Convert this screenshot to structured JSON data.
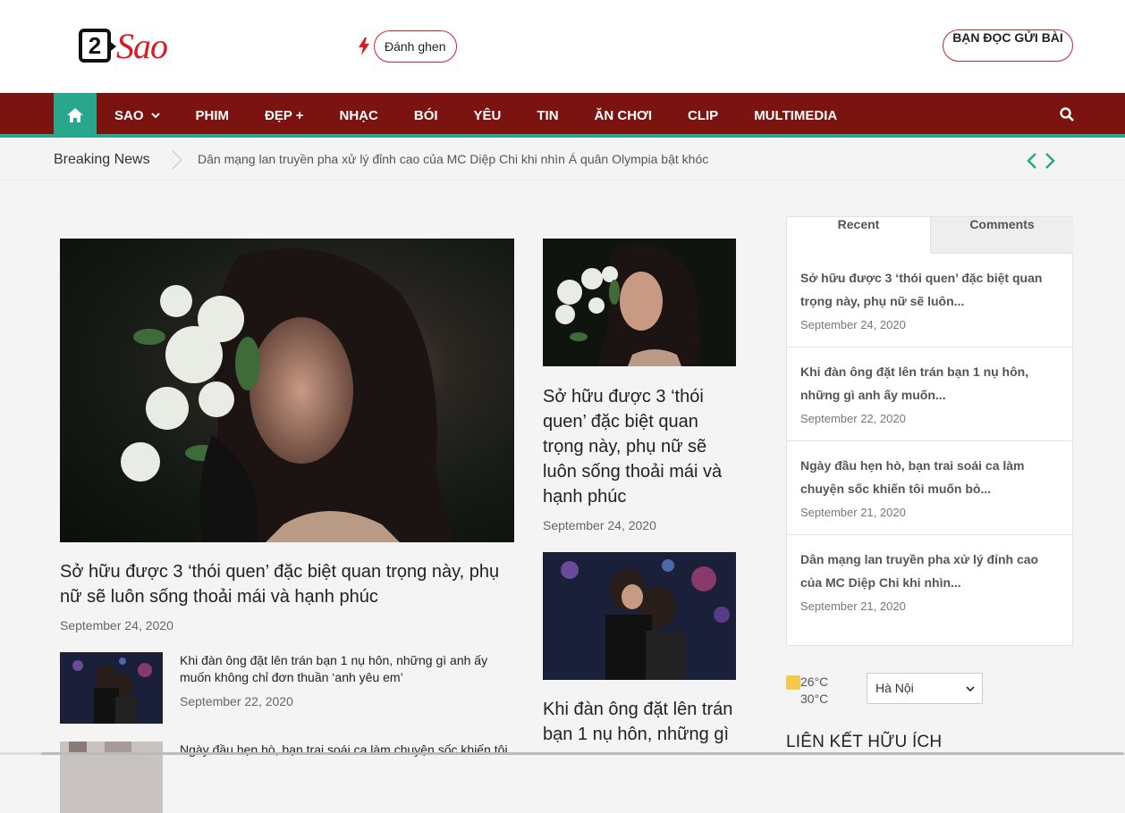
{
  "header": {
    "logo_text": "Sao",
    "logo_number": "2",
    "hot_tag": "Đánh ghen",
    "submit_button": "BẠN ĐỌC GỬI BÀI"
  },
  "nav": {
    "items": [
      "SAO",
      "PHIM",
      "ĐẸP +",
      "NHẠC",
      "BÓI",
      "YÊU",
      "TIN",
      "ĂN CHƠI",
      "CLIP",
      "MULTIMEDIA"
    ]
  },
  "breaking": {
    "label": "Breaking News",
    "headline": "Dân mạng lan truyền pha xử lý đỉnh cao của MC Diệp Chi khi nhìn Á quân Olympia bật khóc"
  },
  "main": {
    "featured": {
      "title": "Sở hữu được 3 ‘thói quen’ đặc biệt quan trọng này, phụ nữ sẽ luôn sống thoải mái và hạnh phúc",
      "date": "September 24, 2020"
    },
    "small_posts": [
      {
        "title": "Khi đàn ông đặt lên trán bạn 1 nụ hôn, những gì anh ấy muốn không chỉ đơn thuần ‘anh yêu em’",
        "date": "September 22, 2020"
      },
      {
        "title": "Ngày đầu hẹn hò, bạn trai soái ca làm chuyện sốc khiến tôi",
        "date": ""
      }
    ],
    "middle_posts": [
      {
        "title": "Sở hữu được 3 ‘thói quen’ đặc biệt quan trọng này, phụ nữ sẽ luôn sống thoải mái và hạnh phúc",
        "date": "September 24, 2020"
      },
      {
        "title": "Khi đàn ông đặt lên trán bạn 1 nụ hôn, những gì",
        "date": ""
      }
    ]
  },
  "sidebar": {
    "tabs": [
      "Recent",
      "Comments"
    ],
    "recent": [
      {
        "title": "Sở hữu được 3 ‘thói quen’ đặc biệt quan trọng này, phụ nữ sẽ luôn...",
        "date": "September 24, 2020"
      },
      {
        "title": "Khi đàn ông đặt lên trán bạn 1 nụ hôn, những gì anh ấy muốn...",
        "date": "September 22, 2020"
      },
      {
        "title": "Ngày đầu hẹn hò, bạn trai soái ca làm chuyện sốc khiến tôi muốn bỏ...",
        "date": "September 21, 2020"
      },
      {
        "title": "Dân mạng lan truyền pha xử lý đỉnh cao của MC Diệp Chi khi nhìn...",
        "date": "September 21, 2020"
      }
    ],
    "weather": {
      "temp_low": "26°C",
      "temp_high": "30°C"
    },
    "city_select": "Hà Nội",
    "links_title": "LIÊN KẾT HỮU ÍCH"
  },
  "colors": {
    "nav_bg": "#7b1410",
    "accent": "#28a78d",
    "brand_red": "#d81b24"
  }
}
